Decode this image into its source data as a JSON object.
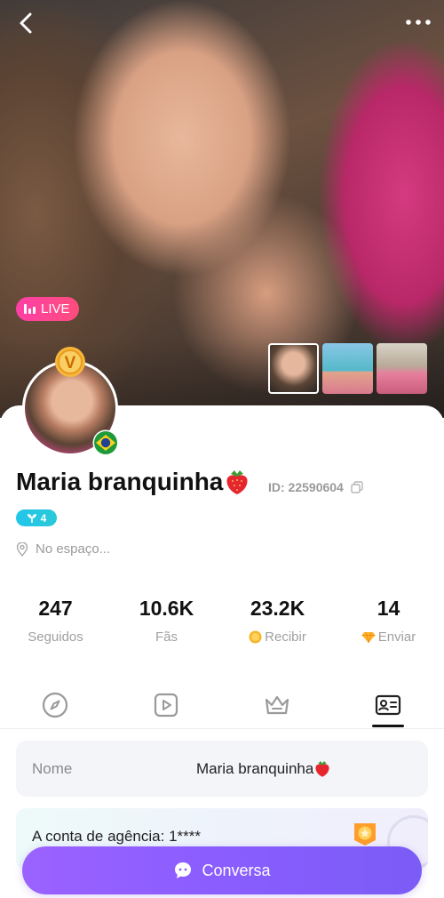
{
  "header": {
    "back_icon": "chevron-left-icon",
    "more_icon": "more-horizontal-icon",
    "live_label": "LIVE",
    "photos": [
      "photo-1",
      "photo-2",
      "photo-3"
    ]
  },
  "profile": {
    "name": "Maria branquinha",
    "name_emoji": "strawberry",
    "id_text": "ID: 22590604",
    "level": "4",
    "location": "No espaço...",
    "vip_badge": "V",
    "country_flag": "Brazil"
  },
  "stats": [
    {
      "value": "247",
      "label": "Seguidos"
    },
    {
      "value": "10.6K",
      "label": "Fãs"
    },
    {
      "value": "23.2K",
      "label": "Recibir",
      "icon": "gold-coin-icon"
    },
    {
      "value": "14",
      "label": "Enviar",
      "icon": "diamond-icon"
    }
  ],
  "tabs": [
    {
      "icon": "compass-icon",
      "active": false
    },
    {
      "icon": "video-play-icon",
      "active": false
    },
    {
      "icon": "crown-icon",
      "active": false
    },
    {
      "icon": "profile-card-icon",
      "active": true
    }
  ],
  "info": {
    "name_key": "Nome",
    "name_value": "Maria branquinha",
    "agency_text": "A conta de agência: 1****"
  },
  "chat_button": {
    "label": "Conversa",
    "icon": "chat-bubble-icon"
  },
  "colors": {
    "live_badge": "#ff3fa6",
    "level_badge": "#22c6ea",
    "chat_button": "#8a5dff",
    "info_bg": "#f4f5f9"
  }
}
